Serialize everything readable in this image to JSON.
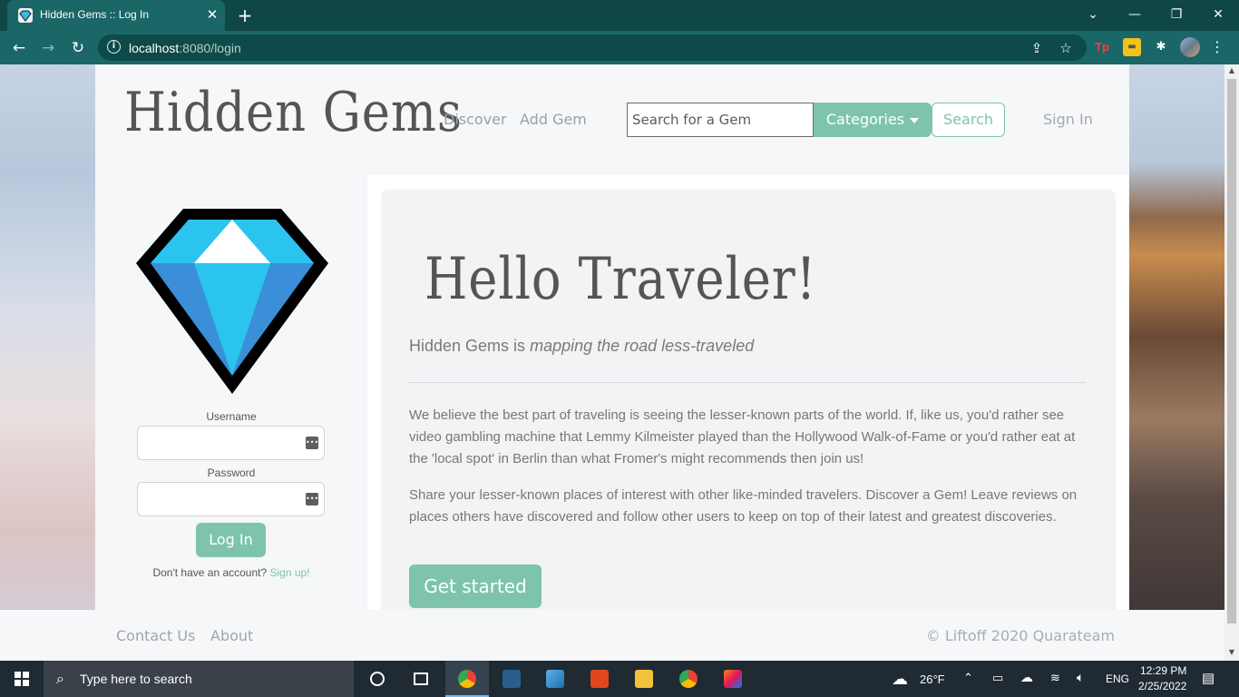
{
  "browser": {
    "tab_title": "Hidden Gems :: Log In",
    "url_host": "localhost",
    "url_rest": ":8080/login"
  },
  "site": {
    "brand": "Hidden Gems",
    "nav": {
      "discover": "Discover",
      "add_gem": "Add Gem"
    },
    "search": {
      "placeholder": "Search for a Gem",
      "categories_label": "Categories",
      "search_label": "Search"
    },
    "signin": "Sign In"
  },
  "login": {
    "username_label": "Username",
    "password_label": "Password",
    "login_label": "Log In",
    "no_account": "Don't have an account?",
    "signup_label": "Sign up!"
  },
  "hero": {
    "heading": "Hello Traveler!",
    "lead_prefix": "Hidden Gems is",
    "lead_emphasis": "mapping the road less-traveled",
    "para1": "We believe the best part of traveling is seeing the lesser-known parts of the world. If, like us, you'd rather see video gambling machine that Lemmy Kilmeister played than the Hollywood Walk-of-Fame or you'd rather eat at the 'local spot' in Berlin than what Fromer's might recommends then join us!",
    "para2": "Share your lesser-known places of interest with other like-minded travelers. Discover a Gem! Leave reviews on places others have discovered and follow other users to keep on top of their latest and greatest discoveries.",
    "cta": "Get started"
  },
  "footer": {
    "contact": "Contact Us",
    "about": "About",
    "copyright": "© Liftoff 2020 Quarateam"
  },
  "taskbar": {
    "search_placeholder": "Type here to search",
    "weather": "26°F",
    "language": "ENG",
    "time": "12:29 PM",
    "date": "2/25/2022"
  },
  "colors": {
    "accent": "#7ec4ac",
    "chrome_dark": "#0f4646",
    "chrome_tab": "#1b6666",
    "text_grey": "#555555"
  }
}
